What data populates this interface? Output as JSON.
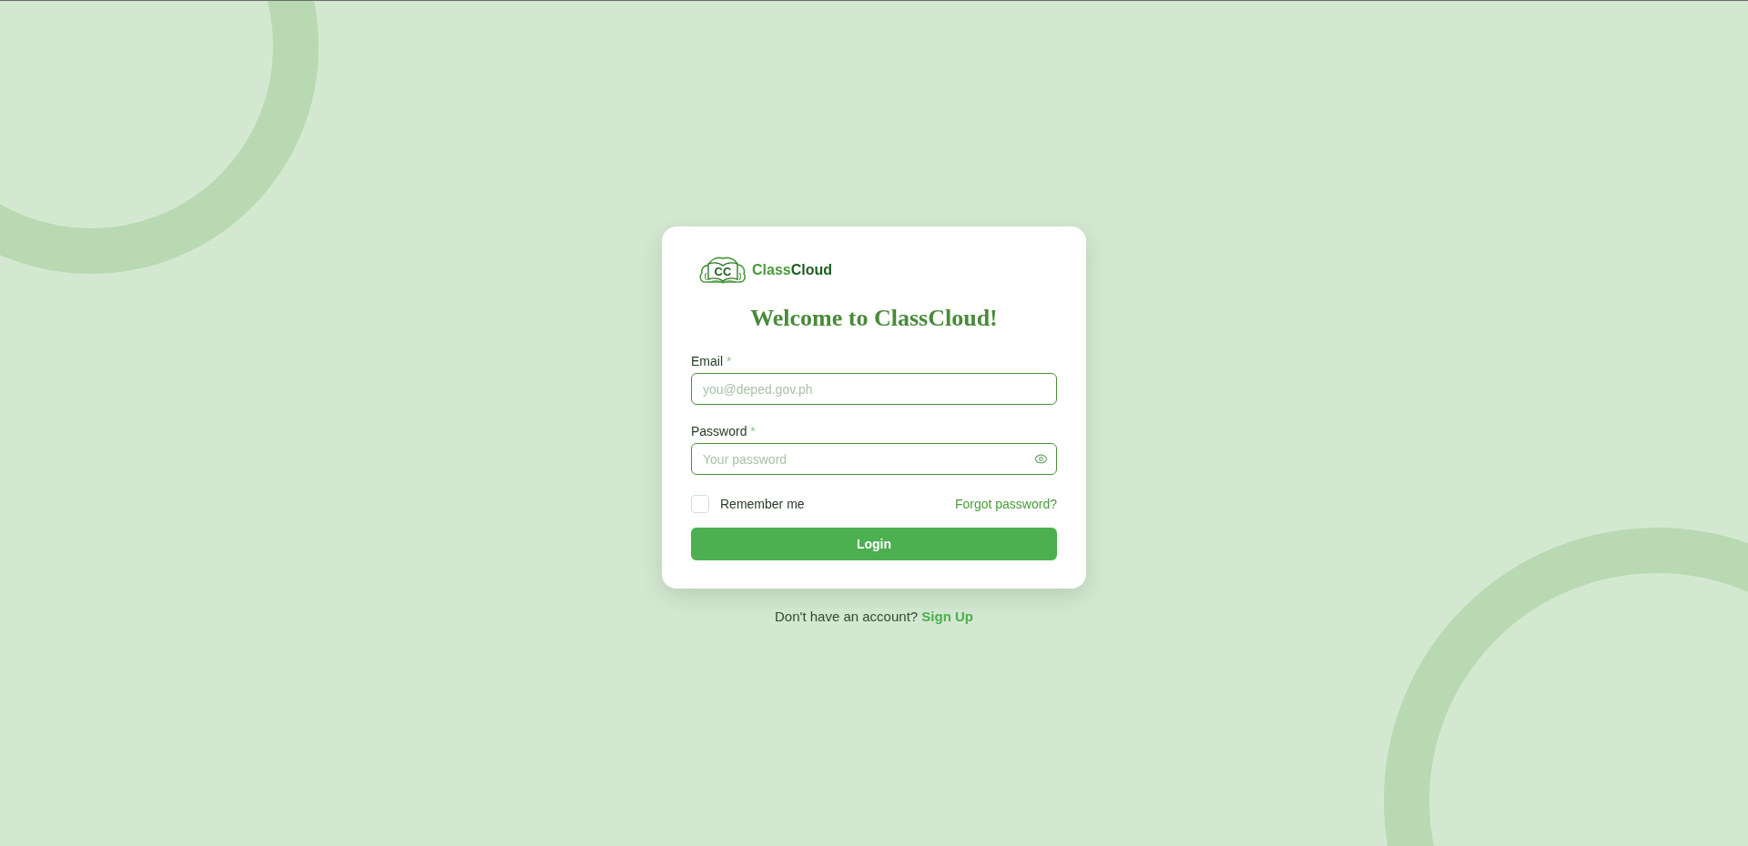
{
  "brand": {
    "logo_mark": "CC",
    "name_parts": [
      {
        "text": "Class",
        "kind": "accent"
      },
      {
        "text": "Cloud",
        "kind": "strong"
      }
    ]
  },
  "title": "Welcome to ClassCloud!",
  "fields": [
    {
      "label": "Email",
      "required_mark": "*",
      "placeholder": "you@deped.gov.ph",
      "kind": "text"
    },
    {
      "label": "Password",
      "required_mark": "*",
      "placeholder": "Your password",
      "kind": "password"
    }
  ],
  "remember": {
    "label": "Remember me",
    "checked": false
  },
  "forgot_link": "Forgot password?",
  "login_button": "Login",
  "footer": {
    "text": "Don't have an account?",
    "link": "Sign Up"
  }
}
